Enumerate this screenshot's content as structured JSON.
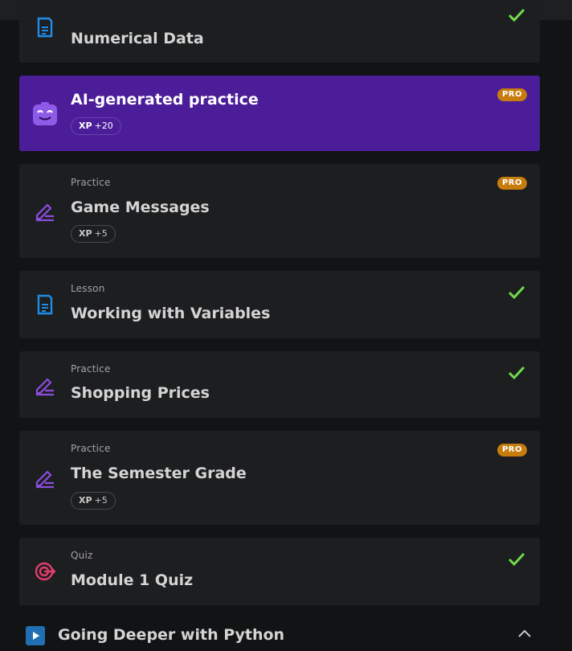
{
  "items": [
    {
      "kind": "",
      "title": "Numerical Data",
      "icon": "lesson-doc-icon",
      "completed": true
    },
    {
      "kind": "",
      "title": "AI-generated practice",
      "icon": "ai-bot-icon",
      "xp_label": "XP",
      "xp_value": "+20",
      "badge": "PRO"
    },
    {
      "kind": "Practice",
      "title": "Game Messages",
      "icon": "pencil-practice-icon",
      "xp_label": "XP",
      "xp_value": "+5",
      "badge": "PRO"
    },
    {
      "kind": "Lesson",
      "title": "Working with Variables",
      "icon": "lesson-doc-icon",
      "completed": true
    },
    {
      "kind": "Practice",
      "title": "Shopping Prices",
      "icon": "pencil-practice-icon",
      "completed": true
    },
    {
      "kind": "Practice",
      "title": "The Semester Grade",
      "icon": "pencil-practice-icon",
      "xp_label": "XP",
      "xp_value": "+5",
      "badge": "PRO"
    },
    {
      "kind": "Quiz",
      "title": "Module 1 Quiz",
      "icon": "target-quiz-icon",
      "completed": true
    }
  ],
  "section": {
    "title": "Going Deeper with Python",
    "icon": "play-module-icon",
    "chevron": "chevron-up-icon"
  },
  "colors": {
    "accent_purple": "#4b1d99",
    "pro_badge": "#c77d0d",
    "check_green": "#6fdc4a",
    "lesson_blue": "#1f8ce6",
    "practice_purple": "#8a4dde",
    "quiz_pink": "#e23d6b"
  }
}
